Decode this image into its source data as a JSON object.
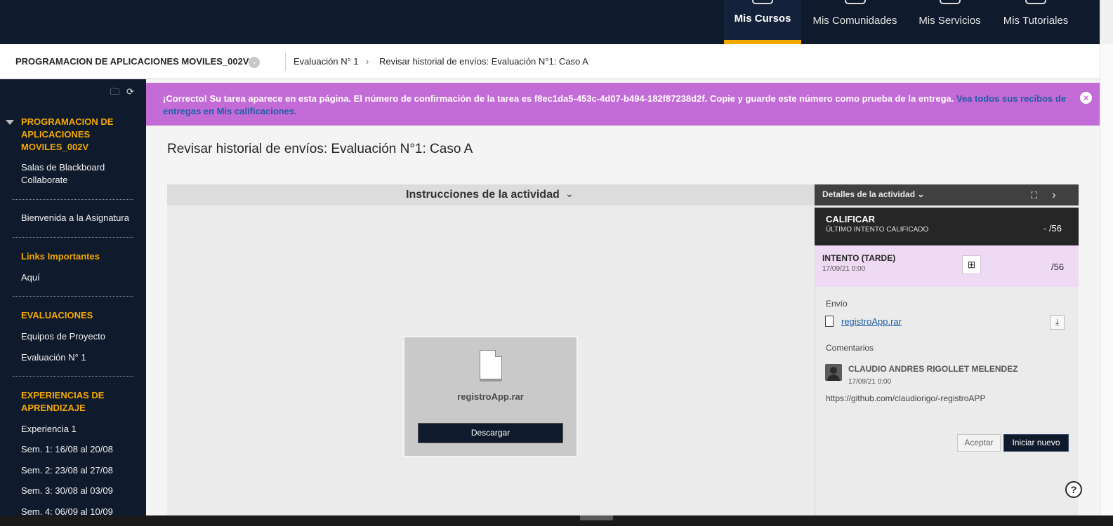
{
  "topnav": {
    "tabs": [
      {
        "label": "Mis Cursos",
        "active": true
      },
      {
        "label": "Mis Comunidades"
      },
      {
        "label": "Mis Servicios"
      },
      {
        "label": "Mis Tutoriales"
      }
    ],
    "accent_color": "#f2a900",
    "bg_color": "#0f1a2c"
  },
  "breadcrumb": {
    "course": "PROGRAMACION DE APLICACIONES MOVILES_002V",
    "items": [
      "Evaluación N° 1",
      "Revisar historial de envíos: Evaluación N°1: Caso A"
    ],
    "separator": "›"
  },
  "sidebar": {
    "tool_icons": [
      "folder-icon",
      "refresh-icon"
    ],
    "course_title": "PROGRAMACION DE APLICACIONES MOVILES_002V",
    "items": [
      {
        "type": "link",
        "label": "Salas de Blackboard Collaborate"
      },
      {
        "type": "link",
        "label": "Bienvenida a la Asignatura"
      },
      {
        "type": "header",
        "label": "Links Importantes"
      },
      {
        "type": "link",
        "label": "Aquí"
      },
      {
        "type": "header",
        "label": "EVALUACIONES"
      },
      {
        "type": "link",
        "label": "Equipos de Proyecto"
      },
      {
        "type": "link",
        "label": "Evaluación N° 1"
      },
      {
        "type": "header",
        "label": "EXPERIENCIAS DE APRENDIZAJE"
      },
      {
        "type": "link",
        "label": "Experiencia 1"
      },
      {
        "type": "link",
        "label": "Sem. 1: 16/08 al 20/08"
      },
      {
        "type": "link",
        "label": "Sem. 2: 23/08 al 27/08"
      },
      {
        "type": "link",
        "label": "Sem. 3: 30/08 al 03/09"
      },
      {
        "type": "link",
        "label": "Sem. 4: 06/09 al 10/09"
      }
    ]
  },
  "banner": {
    "message": "¡Correcto! Su tarea aparece en esta página. El número de confirmación de la tarea es f8ec1da5-453c-4d07-b494-182f87238d2f. Copie y guarde este número como prueba de la entrega.",
    "link": "Vea todos sus recibos de entregas en Mis calificaciones.",
    "bg_color": "#c36bd6"
  },
  "page": {
    "title": "Revisar historial de envíos: Evaluación N°1: Caso A"
  },
  "instructions": {
    "label": "Instrucciones de la actividad"
  },
  "file_card": {
    "filename": "registroApp.rar",
    "download_label": "Descargar"
  },
  "details": {
    "title": "Detalles de la actividad",
    "grade": {
      "title": "CALIFICAR",
      "subtitle": "ÚLTIMO INTENTO CALIFICADO",
      "value": "- /56"
    },
    "attempt": {
      "title": "INTENTO (TARDE)",
      "date": "17/09/21 0:00",
      "value": "/56"
    },
    "submission": {
      "label": "Envío",
      "file": "registroApp.rar"
    },
    "comments": {
      "label": "Comentarios",
      "author": "CLAUDIO ANDRES RIGOLLET MELENDEZ",
      "date": "17/09/21 0:00",
      "text": "https://github.com/claudiorigo/-registroAPP"
    },
    "buttons": {
      "accept": "Aceptar",
      "new_attempt": "Iniciar nuevo"
    }
  }
}
